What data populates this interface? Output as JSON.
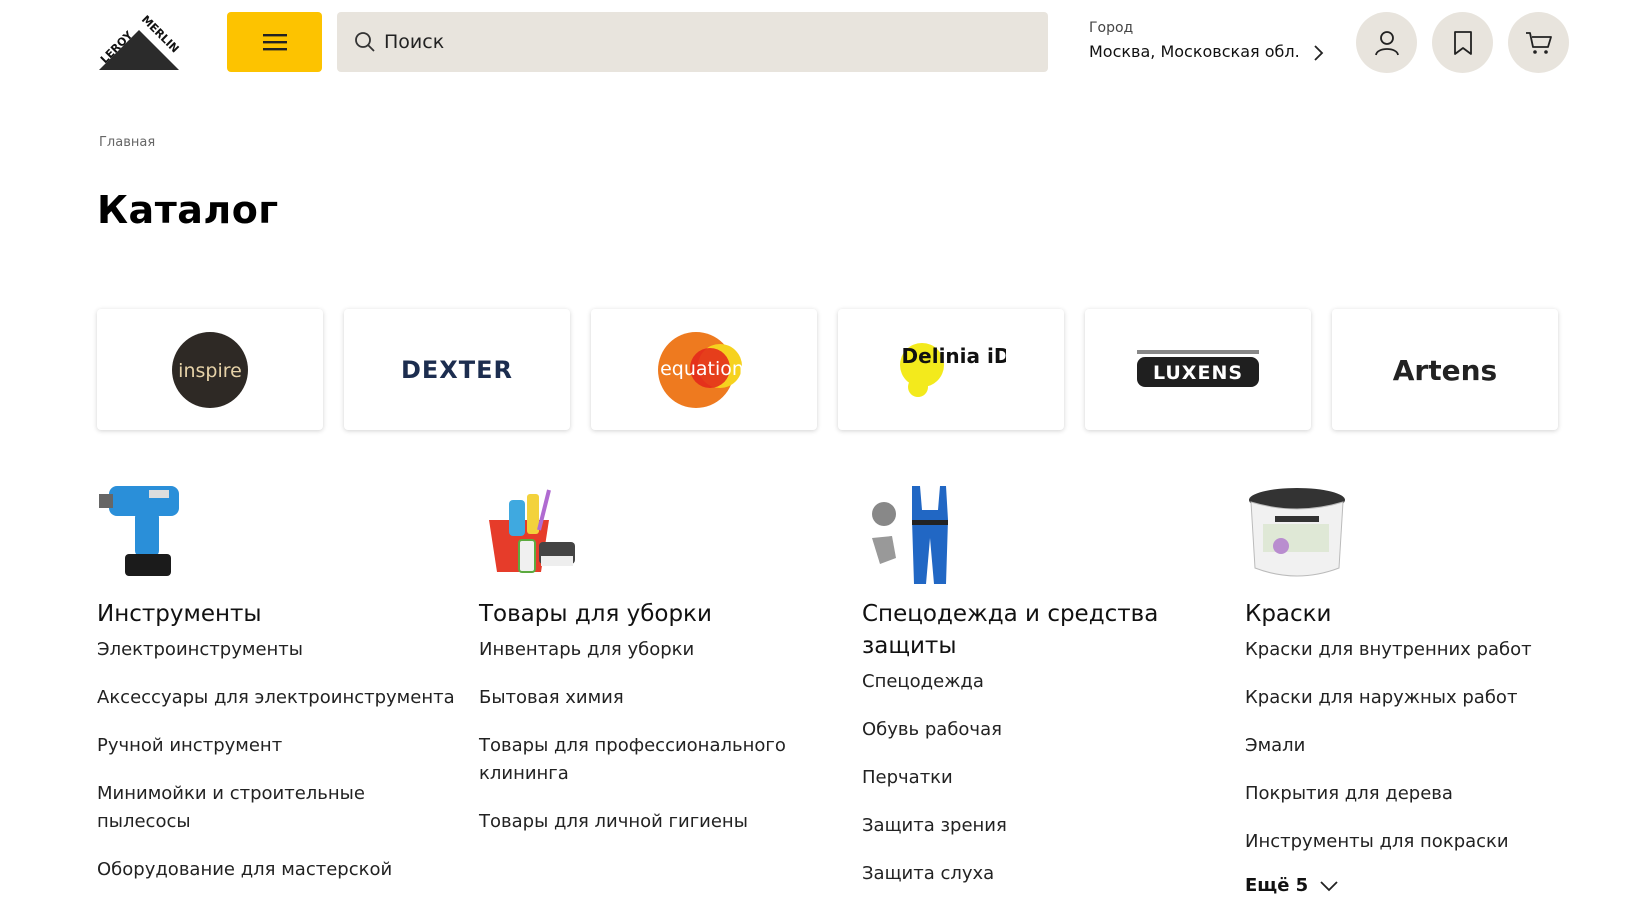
{
  "header": {
    "logo_text_top": "LEROY",
    "logo_text_bottom": "MERLIN",
    "search_placeholder": "Поиск",
    "city_label": "Город",
    "city_value": "Москва, Московская обл.",
    "accent_color": "#FDC300"
  },
  "breadcrumb": [
    "Главная"
  ],
  "page_title": "Каталог",
  "brands": [
    {
      "name": "inspire"
    },
    {
      "name": "DEXTER"
    },
    {
      "name": "equation"
    },
    {
      "name": "Delinia iD"
    },
    {
      "name": "LUXENS"
    },
    {
      "name": "Artens"
    }
  ],
  "categories": [
    {
      "title": "Инструменты",
      "items": [
        "Электроинструменты",
        "Аксессуары для электроинструмента",
        "Ручной инструмент",
        "Минимойки и строительные пылесосы",
        "Оборудование для мастерской"
      ]
    },
    {
      "title": "Товары для уборки",
      "items": [
        "Инвентарь для уборки",
        "Бытовая химия",
        "Товары для профессионального клининга",
        "Товары для личной гигиены"
      ]
    },
    {
      "title": "Спецодежда и средства защиты",
      "items": [
        "Спецодежда",
        "Обувь рабочая",
        "Перчатки",
        "Защита зрения",
        "Защита слуха"
      ]
    },
    {
      "title": "Краски",
      "items": [
        "Краски для внутренних работ",
        "Краски для наружных работ",
        "Эмали",
        "Покрытия для дерева",
        "Инструменты для покраски"
      ],
      "more": "Ещё 5"
    }
  ]
}
